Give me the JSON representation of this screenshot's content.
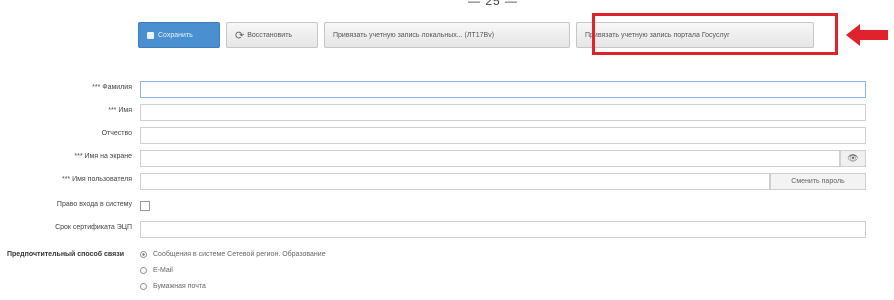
{
  "top_fragment": "— 25 —",
  "toolbar": {
    "save_label": "Сохранить",
    "restore_label": "Восстановить",
    "rights_label": "Привязать учетную запись локальных... (ЛТ17Bv)",
    "portal_label": "Привязать учетную запись портала Госуслуг"
  },
  "form": {
    "surname_label": "*** Фамилия",
    "name_label": "*** Имя",
    "patronymic_label": "Отчество",
    "login_label": "*** Имя на экране",
    "password_label": "*** Имя пользователя",
    "change_password_label": "Сменить пароль",
    "access_label": "Право входа в систему",
    "cert_label": "Срок сертификата ЭЦП",
    "contact_label": "Предпочтительный способ связи",
    "contact_options": [
      {
        "label": "Сообщения в системе Сетевой регион. Образование",
        "checked": true
      },
      {
        "label": "E-Mail",
        "checked": false
      },
      {
        "label": "Бумажная почта",
        "checked": false
      }
    ]
  },
  "colors": {
    "save_button": "#4a8fd0",
    "highlight": "#e0222d"
  },
  "icons": {
    "save": "floppy-icon",
    "restore": "refresh-icon",
    "show_password": "eye-icon",
    "pointer": "red-arrow-icon"
  }
}
